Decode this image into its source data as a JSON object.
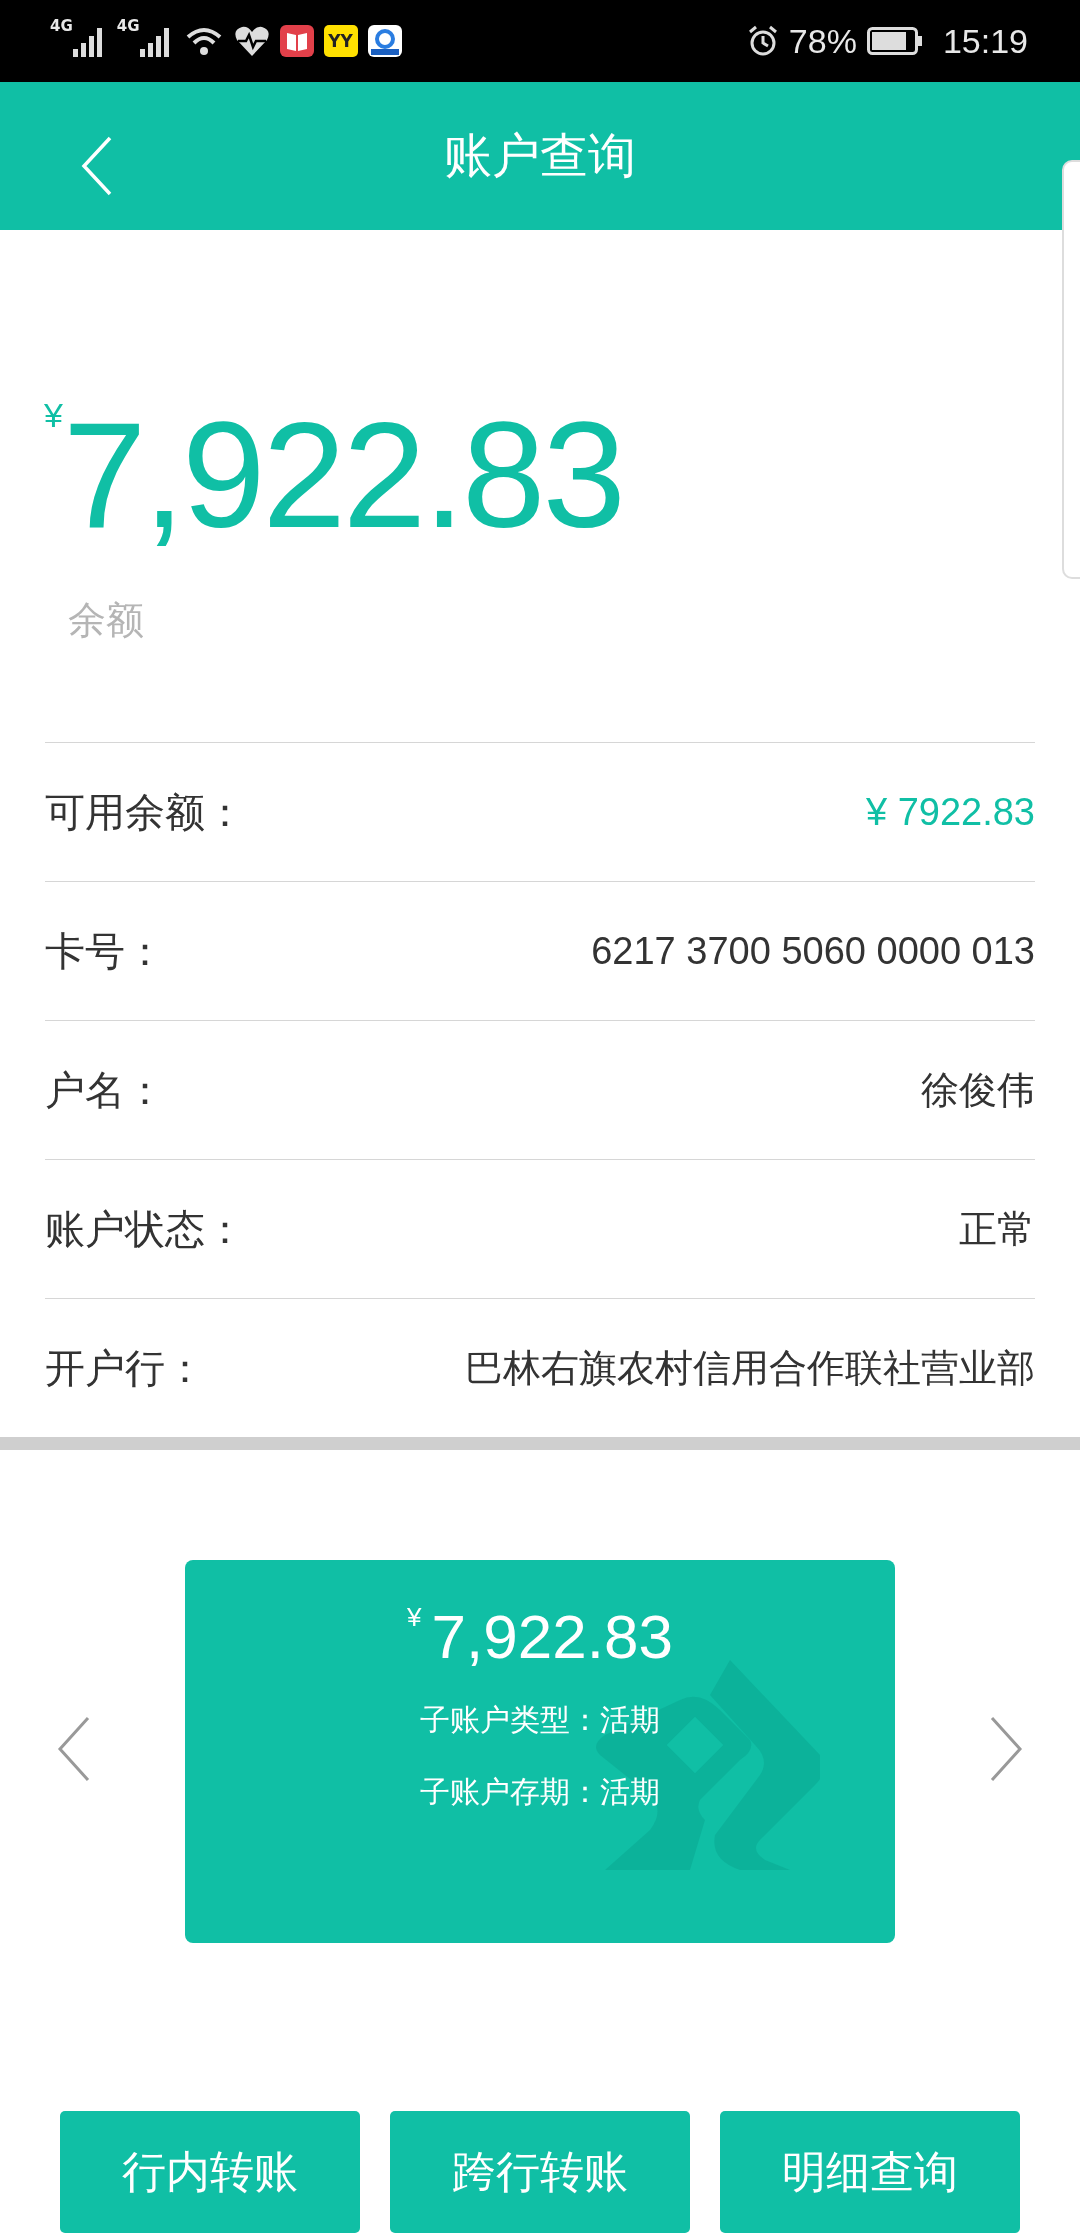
{
  "status_bar": {
    "networks": [
      "4G",
      "4G"
    ],
    "app_badge": "YY",
    "battery": "78%",
    "time": "15:19"
  },
  "header": {
    "title": "账户查询"
  },
  "balance": {
    "currency": "¥",
    "amount": "7,922.83",
    "label": "余额"
  },
  "details": [
    {
      "label": "可用余额：",
      "value": "¥ 7922.83",
      "highlight": true
    },
    {
      "label": "卡号：",
      "value": "6217 3700 5060 0000 013",
      "highlight": false
    },
    {
      "label": "户名：",
      "value": "徐俊伟",
      "highlight": false
    },
    {
      "label": "账户状态：",
      "value": "正常",
      "highlight": false
    },
    {
      "label": "开户行：",
      "value": "巴林右旗农村信用合作联社营业部",
      "highlight": false
    }
  ],
  "sub_account_card": {
    "currency": "¥",
    "amount": "7,922.83",
    "lines": [
      "子账户类型：活期",
      "子账户存期：活期"
    ]
  },
  "actions": [
    "行内转账",
    "跨行转账",
    "明细查询"
  ]
}
